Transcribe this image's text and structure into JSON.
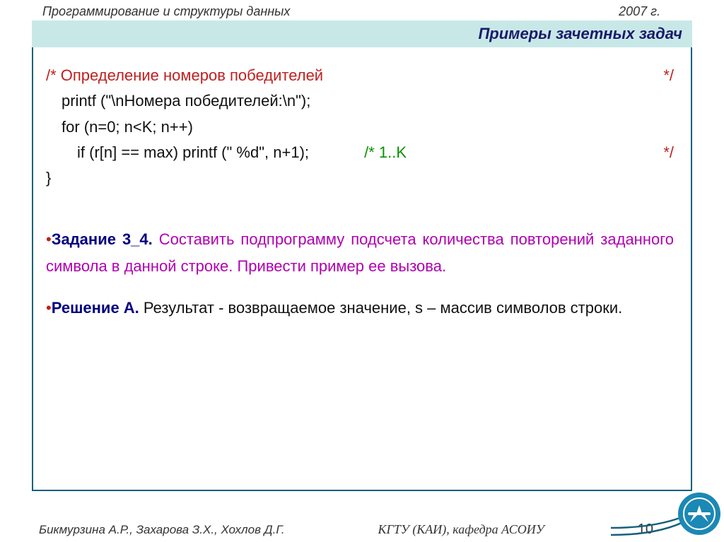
{
  "header": {
    "course": "Программирование  и структуры данных",
    "year": "2007 г."
  },
  "title": "Примеры зачетных задач",
  "code": {
    "comment_open": "/* Определение номеров победителей",
    "comment_close": "*/",
    "line1": "printf (\"\\nНомера победителей:\\n\");",
    "line2": "for (n=0; n<K; n++)",
    "line3_code": "if (r[n] == max) printf (\" %d\", n+1);",
    "line3_cmt": "/*    1..K",
    "line3_close": "*/",
    "brace": "}"
  },
  "task": {
    "label": "Задание 3_4.",
    "text": " Составить подпрограмму подсчета количества повторений заданного символа в данной строке. Привести пример ее вызова."
  },
  "solution": {
    "label": "Решение А.",
    "text": " Результат - возвращаемое значение, s – массив символов строки."
  },
  "footer": {
    "authors": "Бикмурзина А.Р., Захарова З.Х., Хохлов Д.Г.",
    "dept": "КГТУ  (КАИ),   кафедра АСОИУ",
    "page": "10"
  }
}
